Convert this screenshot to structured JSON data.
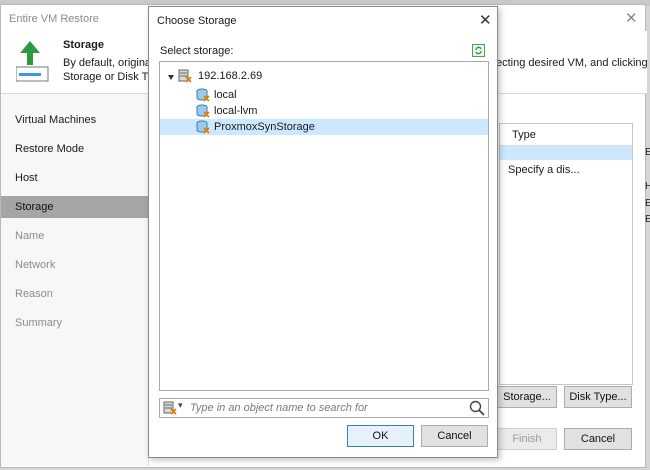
{
  "wizard": {
    "title": "Entire VM Restore",
    "close_glyph": "✕",
    "header": {
      "title": "Storage",
      "desc_line1": "By default, original",
      "desc_line2": "Storage or Disk Typ",
      "desc_right": "ecting desired VM, and clicking"
    },
    "steps": [
      {
        "label": "Virtual Machines",
        "state": "done"
      },
      {
        "label": "Restore Mode",
        "state": "done"
      },
      {
        "label": "Host",
        "state": "done"
      },
      {
        "label": "Storage",
        "state": "active"
      },
      {
        "label": "Name",
        "state": "disabled"
      },
      {
        "label": "Network",
        "state": "disabled"
      },
      {
        "label": "Reason",
        "state": "disabled"
      },
      {
        "label": "Summary",
        "state": "disabled"
      }
    ],
    "grid": {
      "column_header": "Type",
      "cell": "Specify a dis..."
    },
    "side_fragments": [
      "E",
      "H",
      "E",
      "E"
    ],
    "buttons": {
      "storage": "Storage...",
      "disk_type": "Disk Type...",
      "finish": "Finish",
      "cancel": "Cancel"
    }
  },
  "dialog": {
    "title": "Choose Storage",
    "close_glyph": "✕",
    "select_label": "Select storage:",
    "tree": {
      "host": "192.168.2.69",
      "items": [
        {
          "label": "local",
          "selected": false
        },
        {
          "label": "local-lvm",
          "selected": false
        },
        {
          "label": "ProxmoxSynStorage",
          "selected": true
        }
      ]
    },
    "search": {
      "placeholder": "Type in an object name to search for",
      "value": ""
    },
    "buttons": {
      "ok": "OK",
      "cancel": "Cancel"
    }
  },
  "colors": {
    "selection": "#cce8ff",
    "active_step": "#a5a5a5",
    "arrow_green": "#2e9a3e",
    "ok_border": "#3c7fb1"
  }
}
